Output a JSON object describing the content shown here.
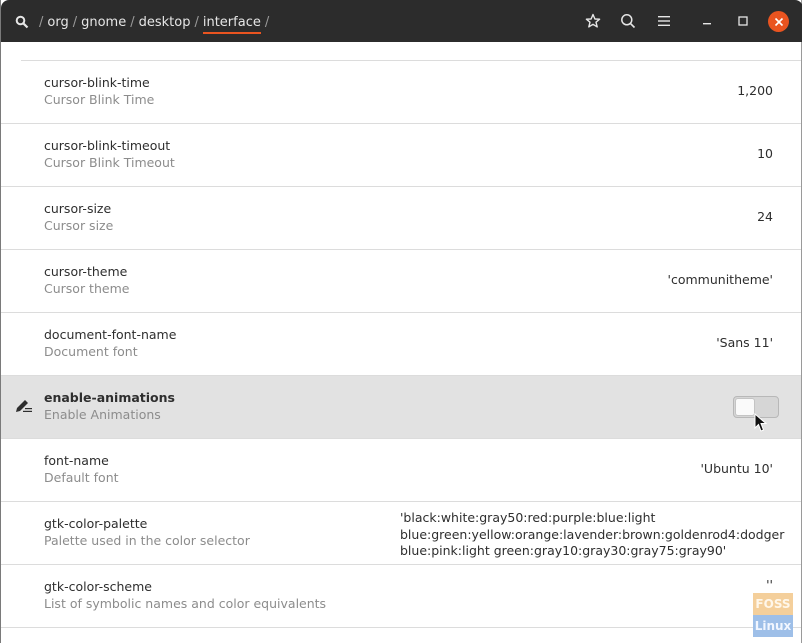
{
  "header": {
    "path": [
      "org",
      "gnome",
      "desktop",
      "interface"
    ],
    "active_crumb": "interface",
    "separator": "/",
    "icons": {
      "search_path": "search-path-icon",
      "bookmark": "star-icon",
      "search": "search-icon",
      "menu": "hamburger-menu-icon",
      "minimize": "minimize-icon",
      "maximize": "maximize-icon",
      "close": "close-icon"
    },
    "accent_color": "#e95420"
  },
  "keys": [
    {
      "name": "cursor-blink-time",
      "summary": "Cursor Blink Time",
      "value": "1,200"
    },
    {
      "name": "cursor-blink-timeout",
      "summary": "Cursor Blink Timeout",
      "value": "10"
    },
    {
      "name": "cursor-size",
      "summary": "Cursor size",
      "value": "24"
    },
    {
      "name": "cursor-theme",
      "summary": "Cursor theme",
      "value": "'communitheme'"
    },
    {
      "name": "document-font-name",
      "summary": "Document font",
      "value": "'Sans 11'"
    },
    {
      "name": "enable-animations",
      "summary": "Enable Animations",
      "value": false,
      "type": "toggle",
      "modified": true
    },
    {
      "name": "font-name",
      "summary": "Default font",
      "value": "'Ubuntu 10'"
    },
    {
      "name": "gtk-color-palette",
      "summary": "Palette used in the color selector",
      "value": "'black:white:gray50:red:purple:blue:light\nblue:green:yellow:orange:lavender:brown:goldenrod4:dodger\nblue:pink:light green:gray10:gray30:gray75:gray90'"
    },
    {
      "name": "gtk-color-scheme",
      "summary": "List of symbolic names and color equivalents",
      "value": "''"
    }
  ],
  "watermark": {
    "line1": "FOSS",
    "line2": "Linux"
  }
}
